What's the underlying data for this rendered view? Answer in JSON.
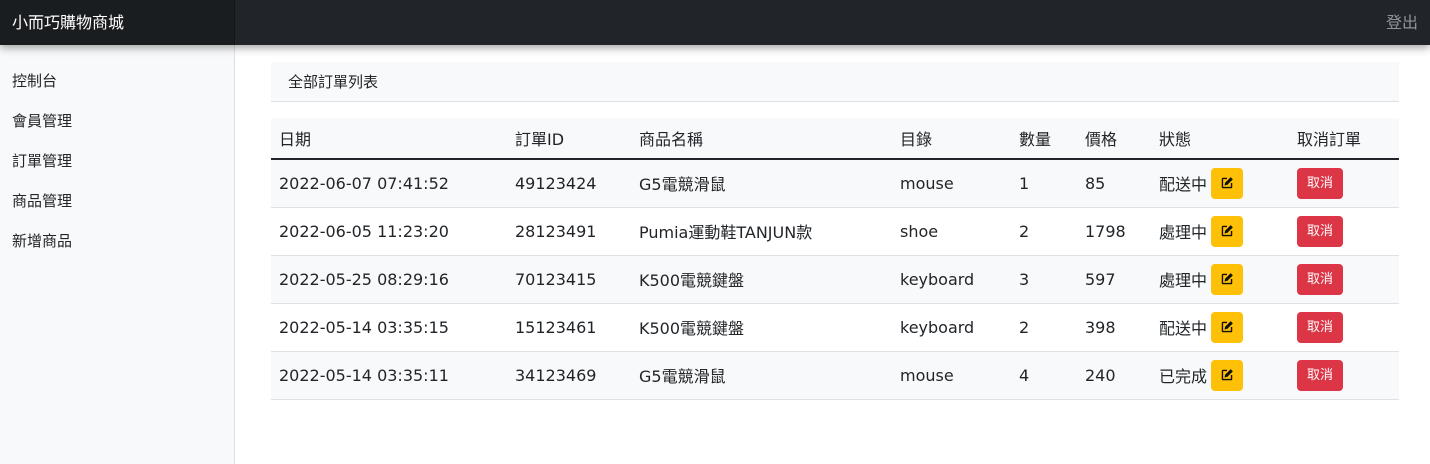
{
  "header": {
    "brand": "小而巧購物商城",
    "logout_label": "登出"
  },
  "sidebar": {
    "items": [
      {
        "label": "控制台"
      },
      {
        "label": "會員管理"
      },
      {
        "label": "訂單管理"
      },
      {
        "label": "商品管理"
      },
      {
        "label": "新增商品"
      }
    ]
  },
  "main": {
    "section_title": "全部訂單列表",
    "table": {
      "headers": [
        "日期",
        "訂單ID",
        "商品名稱",
        "目錄",
        "數量",
        "價格",
        "狀態",
        "取消訂單"
      ],
      "rows": [
        {
          "date": "2022-06-07 07:41:52",
          "order_id": "49123424",
          "product": "G5電競滑鼠",
          "category": "mouse",
          "quantity": "1",
          "price": "85",
          "status": "配送中",
          "cancel_label": "取消"
        },
        {
          "date": "2022-06-05 11:23:20",
          "order_id": "28123491",
          "product": "Pumia運動鞋TANJUN款",
          "category": "shoe",
          "quantity": "2",
          "price": "1798",
          "status": "處理中",
          "cancel_label": "取消"
        },
        {
          "date": "2022-05-25 08:29:16",
          "order_id": "70123415",
          "product": "K500電競鍵盤",
          "category": "keyboard",
          "quantity": "3",
          "price": "597",
          "status": "處理中",
          "cancel_label": "取消"
        },
        {
          "date": "2022-05-14 03:35:15",
          "order_id": "15123461",
          "product": "K500電競鍵盤",
          "category": "keyboard",
          "quantity": "2",
          "price": "398",
          "status": "配送中",
          "cancel_label": "取消"
        },
        {
          "date": "2022-05-14 03:35:11",
          "order_id": "34123469",
          "product": "G5電競滑鼠",
          "category": "mouse",
          "quantity": "4",
          "price": "240",
          "status": "已完成",
          "cancel_label": "取消"
        }
      ]
    }
  },
  "icons": {
    "edit": "pencil-square-icon"
  },
  "colors": {
    "navbar": "#212529",
    "edit_button": "#ffc107",
    "cancel_button": "#dc3545"
  }
}
